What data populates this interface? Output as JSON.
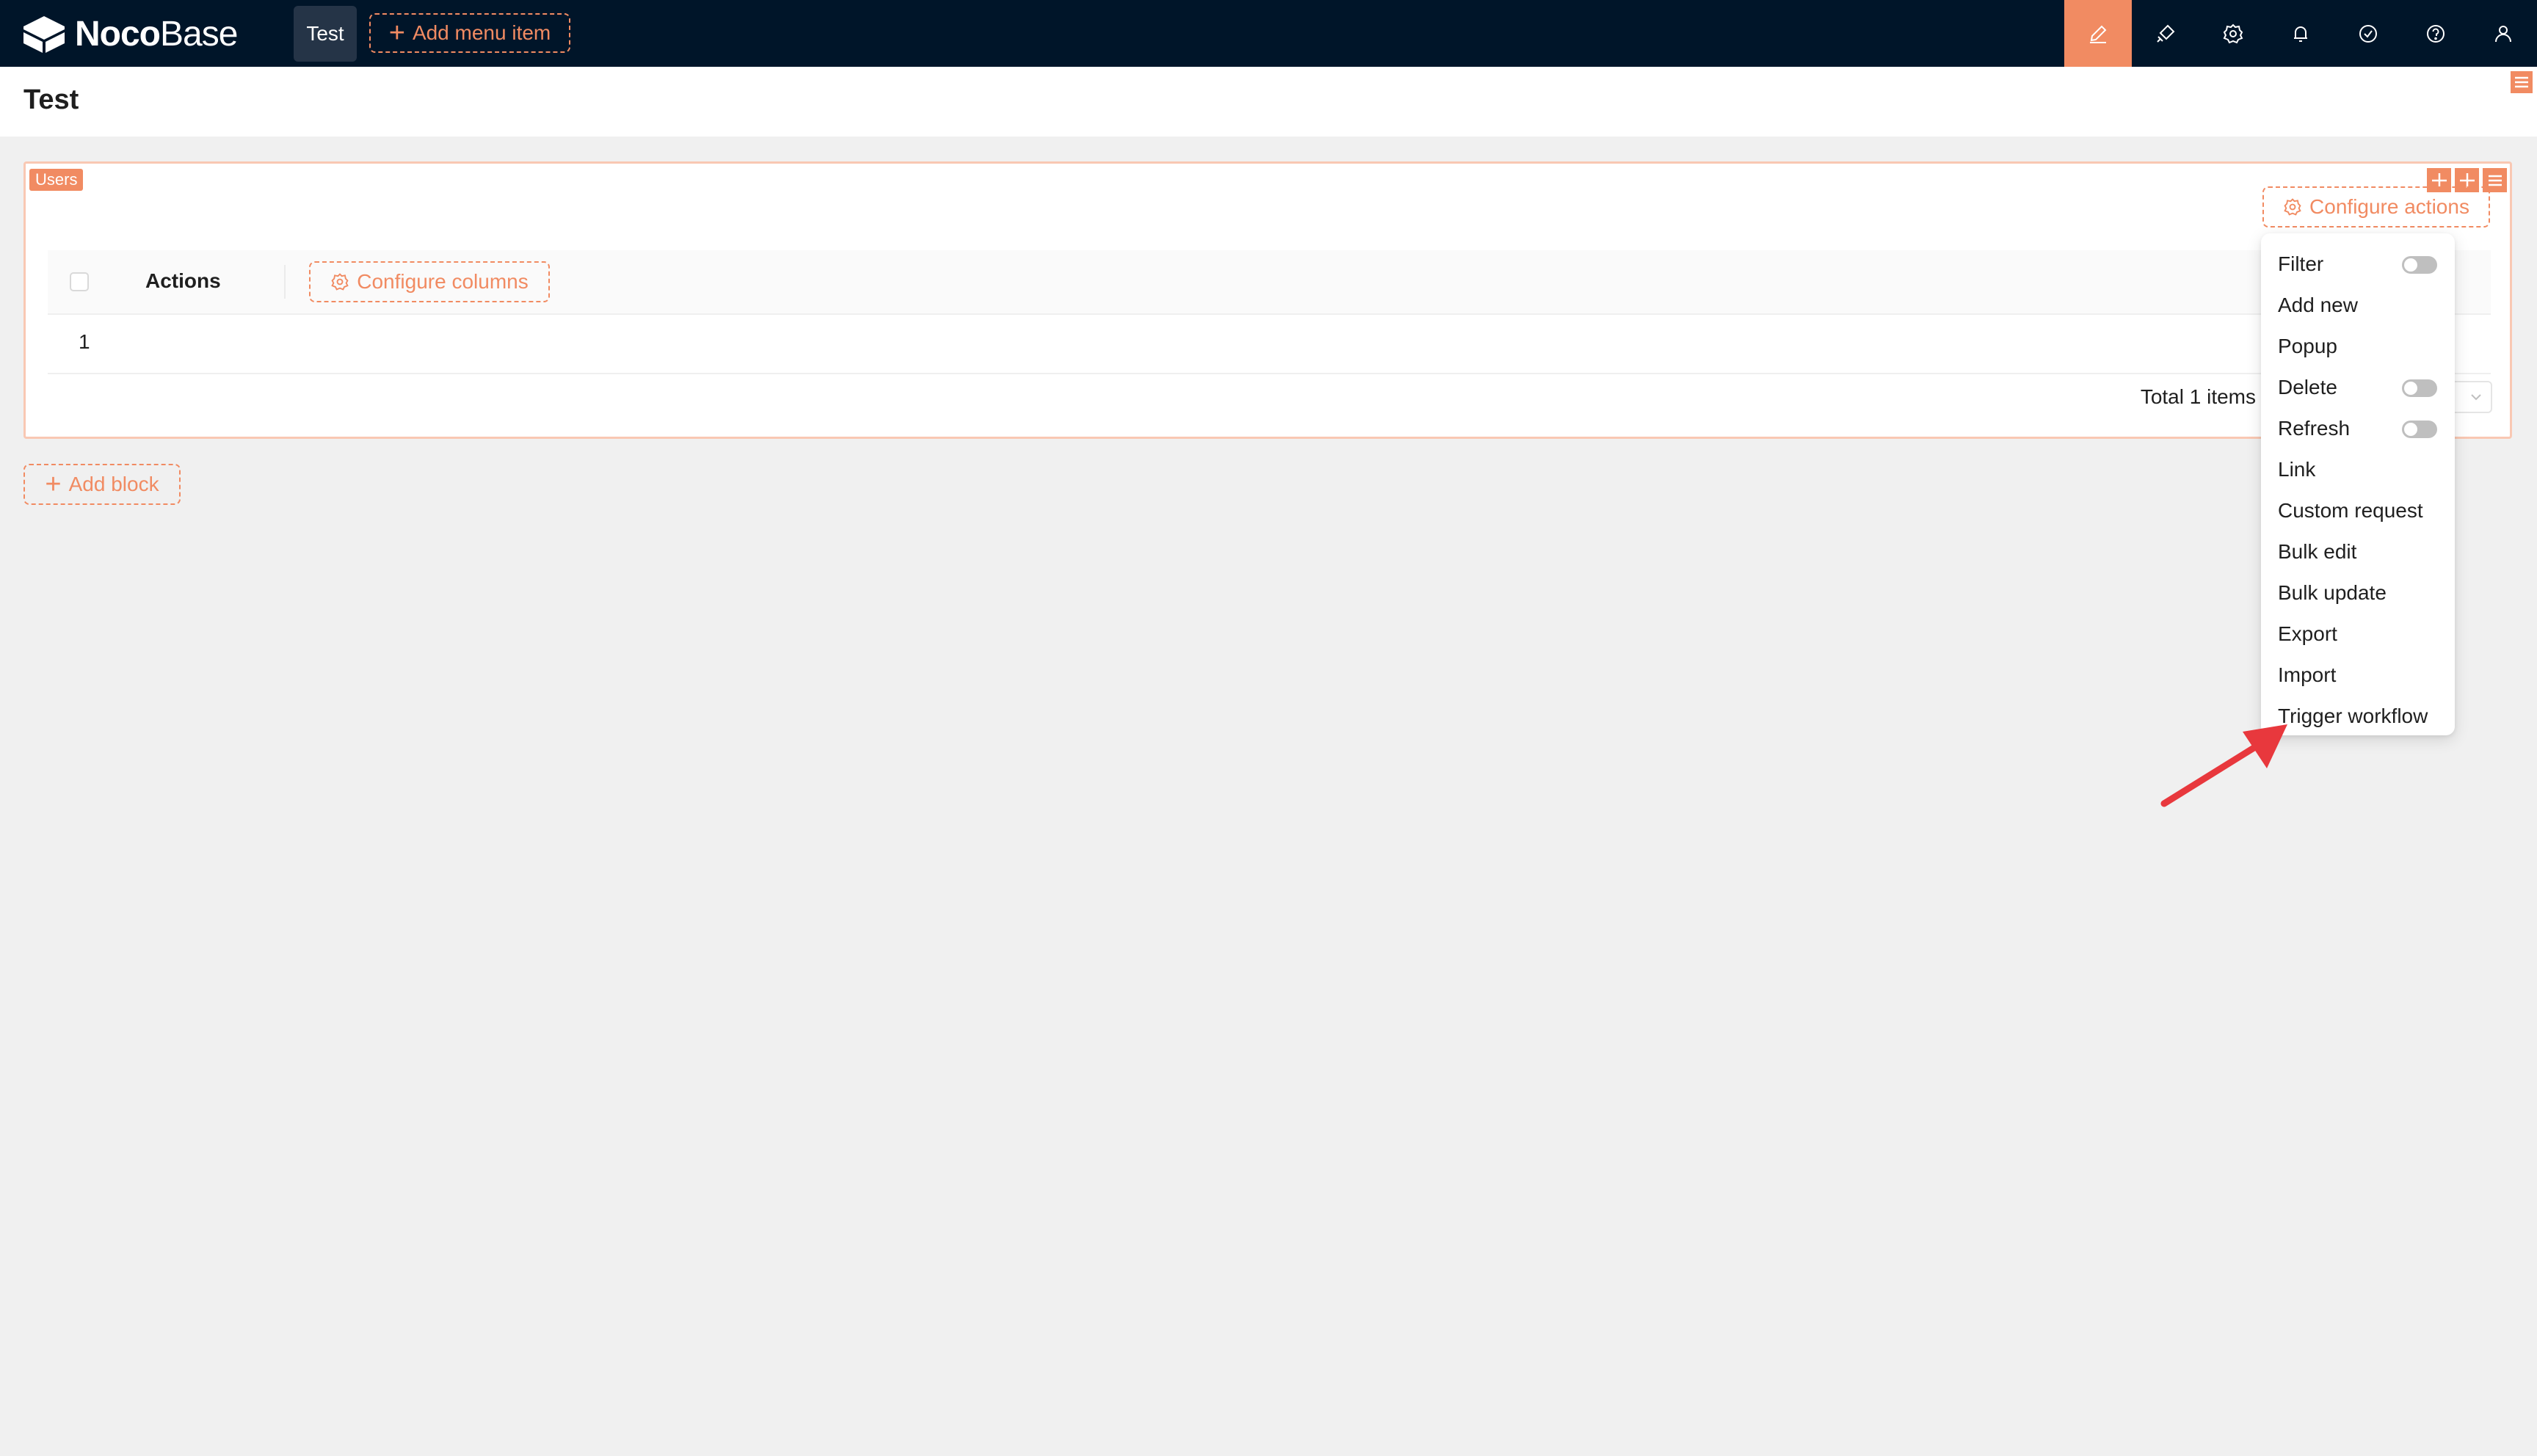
{
  "app": {
    "logo_bold": "Noco",
    "logo_light": "Base"
  },
  "topnav": {
    "menu_items": [
      {
        "label": "Test"
      }
    ],
    "add_menu_label": "Add menu item",
    "icons": [
      "ui-editor-icon",
      "plugin-icon",
      "settings-icon",
      "notification-icon",
      "tasks-icon",
      "help-icon",
      "user-icon"
    ]
  },
  "page": {
    "title": "Test"
  },
  "block": {
    "collection_tag": "Users",
    "configure_actions_label": "Configure actions",
    "table": {
      "columns": [
        "Actions"
      ],
      "configure_columns_label": "Configure columns",
      "rows": [
        {
          "index": "1"
        }
      ]
    },
    "pagination": {
      "total_text": "Total 1 items"
    }
  },
  "add_block_label": "Add block",
  "actions_menu": {
    "items": [
      {
        "label": "Filter",
        "toggle": false
      },
      {
        "label": "Add new"
      },
      {
        "label": "Popup"
      },
      {
        "label": "Delete",
        "toggle": false
      },
      {
        "label": "Refresh",
        "toggle": false
      },
      {
        "label": "Link"
      },
      {
        "label": "Custom request"
      },
      {
        "label": "Bulk edit"
      },
      {
        "label": "Bulk update"
      },
      {
        "label": "Export"
      },
      {
        "label": "Import"
      },
      {
        "label": "Trigger workflow"
      }
    ]
  },
  "colors": {
    "accent": "#f18b62",
    "nav_bg": "#001529",
    "annotation_arrow": "#e8383d"
  }
}
